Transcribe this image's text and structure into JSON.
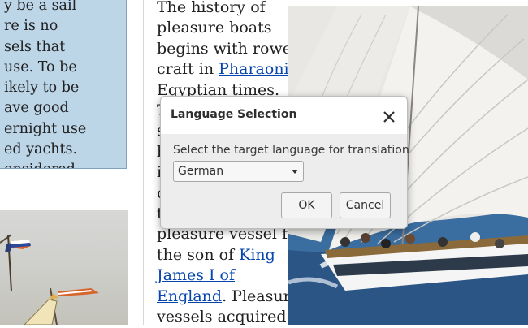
{
  "left_box": {
    "lines": [
      "y be a sail",
      "re is no",
      "sels that",
      "use. To be",
      "ikely to be",
      "ave good",
      "ernight use",
      "ed yachts.",
      "onsidered"
    ]
  },
  "article": {
    "line1": "The history of",
    "line2": "pleasure boats",
    "line3": "begins with rowed",
    "line4_pre": "craft in ",
    "line4_link": "Pharaonic",
    "line5": "Egyptian times.",
    "line6": "T",
    "line7": "s",
    "line8": "b",
    "line9": "i",
    "line10": "c",
    "line11": "t",
    "line12": "pleasure vessel for",
    "line13_pre": "the son of ",
    "line13_link": "King",
    "line14_link": "James I of",
    "line15_link": "England",
    "line15_post": ". Pleasure",
    "line16": "vessels acquired"
  },
  "dialog": {
    "title": "Language Selection",
    "prompt": "Select the target language for translation",
    "selected_language": "German",
    "ok_label": "OK",
    "cancel_label": "Cancel"
  }
}
